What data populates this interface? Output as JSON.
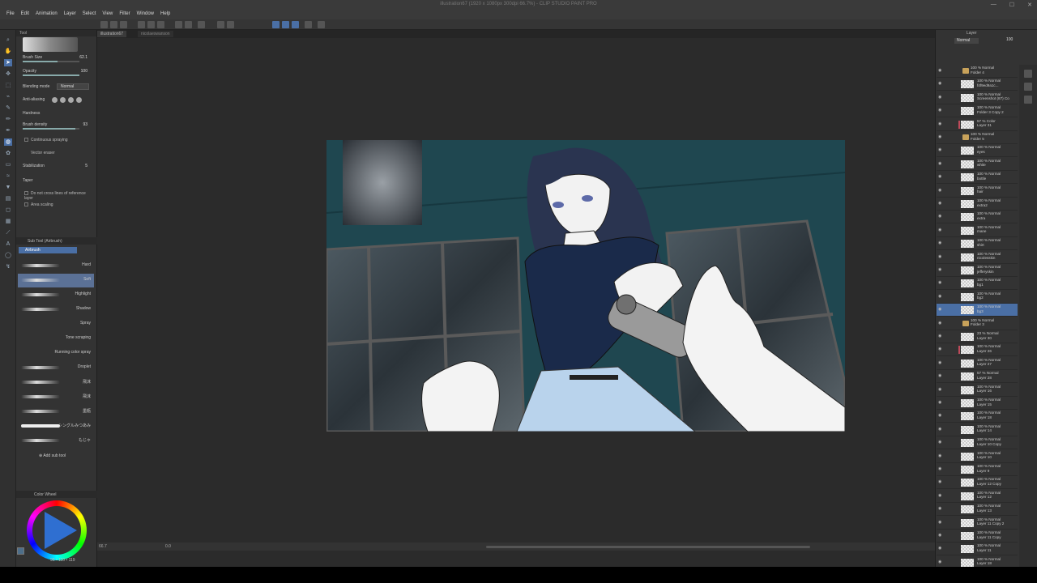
{
  "window": {
    "title": "illustration67 (1920 x 1080px 300dpi 66.7%) - CLIP STUDIO PAINT PRO"
  },
  "menu": [
    "File",
    "Edit",
    "Animation",
    "Layer",
    "Select",
    "View",
    "Filter",
    "Window",
    "Help"
  ],
  "tabs": [
    {
      "label": "illustration67"
    },
    {
      "label": "nicolaeswanson"
    }
  ],
  "tool_property": {
    "header": "Tool",
    "brush_size_label": "Brush Size",
    "brush_size_value": "62.1",
    "opacity_label": "Opacity",
    "opacity_value": "100",
    "blending_label": "Blending mode",
    "blending_value": "Normal",
    "antialias_label": "Anti-aliasing",
    "hardness_label": "Hardness",
    "density_label": "Brush density",
    "density_value": "93",
    "continuous_label": "Continuous spraying",
    "vector_eraser_label": "Vector eraser",
    "stabilization_label": "Stabilization",
    "stabilization_value": "5",
    "taper_label": "Taper",
    "no_cross_label": "Do not cross lines of reference layer",
    "area_scaling_label": "Area scaling"
  },
  "subtool": {
    "header": "Sub Tool (Airbrush)",
    "group": "Airbrush",
    "items": [
      "Hard",
      "Soft",
      "Highlight",
      "Shadow",
      "Spray",
      "Tone scraping",
      "Running color spray",
      "Droplet",
      "飛沫",
      "飛沫",
      "墨瓶",
      "シングルみつあみ",
      "もじゃ"
    ],
    "add_label": "Add sub tool"
  },
  "color_wheel": {
    "header": "Color Wheel",
    "hsv": "96 • 110 • 119",
    "current_color": "#4d6e8a"
  },
  "status": {
    "zoom": "66.7",
    "angle": "0.0"
  },
  "layer_panel": {
    "tab": "Layer",
    "blend": "Normal",
    "opacity": "100",
    "layers": [
      {
        "kind": "folder",
        "line1": "100 % Normal",
        "line2": "Folder 4"
      },
      {
        "kind": "layer",
        "line1": "100 % Normal",
        "line2": "f4f9ed9a1c..."
      },
      {
        "kind": "layer",
        "line1": "100 % Normal",
        "line2": "Screenshot (87) Co"
      },
      {
        "kind": "layer",
        "line1": "100 % Normal",
        "line2": "Folder 3 Copy 2"
      },
      {
        "kind": "layer",
        "line1": "57 % Color",
        "line2": "Layer 31",
        "clip": true
      },
      {
        "kind": "folder",
        "line1": "100 % Normal",
        "line2": "Folder 5"
      },
      {
        "kind": "layer",
        "line1": "100 % Normal",
        "line2": "eyes"
      },
      {
        "kind": "layer",
        "line1": "100 % Normal",
        "line2": "white"
      },
      {
        "kind": "layer",
        "line1": "100 % Normal",
        "line2": "bottle"
      },
      {
        "kind": "layer",
        "line1": "100 % Normal",
        "line2": "hair"
      },
      {
        "kind": "layer",
        "line1": "100 % Normal",
        "line2": "extra2"
      },
      {
        "kind": "layer",
        "line1": "100 % Normal",
        "line2": "extra"
      },
      {
        "kind": "layer",
        "line1": "100 % Normal",
        "line2": "mane"
      },
      {
        "kind": "layer",
        "line1": "100 % Normal",
        "line2": "shirt"
      },
      {
        "kind": "layer",
        "line1": "100 % Normal",
        "line2": "nicolesskin"
      },
      {
        "kind": "layer",
        "line1": "100 % Normal",
        "line2": "jefferyskin"
      },
      {
        "kind": "layer",
        "line1": "100 % Normal",
        "line2": "bg1"
      },
      {
        "kind": "layer",
        "line1": "100 % Normal",
        "line2": "bg2"
      },
      {
        "kind": "layer",
        "line1": "100 % Normal",
        "line2": "bg3",
        "selected": true
      },
      {
        "kind": "folder",
        "line1": "100 % Normal",
        "line2": "Folder 3"
      },
      {
        "kind": "layer",
        "line1": "23 % Normal",
        "line2": "Layer 30"
      },
      {
        "kind": "layer",
        "line1": "100 % Normal",
        "line2": "Layer 26",
        "clip": true
      },
      {
        "kind": "layer",
        "line1": "100 % Normal",
        "line2": "Layer 27"
      },
      {
        "kind": "layer",
        "line1": "57 % Normal",
        "line2": "Layer 28"
      },
      {
        "kind": "layer",
        "line1": "100 % Normal",
        "line2": "Layer 16"
      },
      {
        "kind": "layer",
        "line1": "100 % Normal",
        "line2": "Layer 15"
      },
      {
        "kind": "layer",
        "line1": "100 % Normal",
        "line2": "Layer 18"
      },
      {
        "kind": "layer",
        "line1": "100 % Normal",
        "line2": "Layer 14"
      },
      {
        "kind": "layer",
        "line1": "100 % Normal",
        "line2": "Layer 10 Copy"
      },
      {
        "kind": "layer",
        "line1": "100 % Normal",
        "line2": "Layer 10"
      },
      {
        "kind": "layer",
        "line1": "100 % Normal",
        "line2": "Layer 9"
      },
      {
        "kind": "layer",
        "line1": "100 % Normal",
        "line2": "Layer 12 Copy"
      },
      {
        "kind": "layer",
        "line1": "100 % Normal",
        "line2": "Layer 12"
      },
      {
        "kind": "layer",
        "line1": "100 % Normal",
        "line2": "Layer 13"
      },
      {
        "kind": "layer",
        "line1": "100 % Normal",
        "line2": "Layer 11 Copy 2"
      },
      {
        "kind": "layer",
        "line1": "100 % Normal",
        "line2": "Layer 11 Copy"
      },
      {
        "kind": "layer",
        "line1": "100 % Normal",
        "line2": "Layer 11"
      },
      {
        "kind": "layer",
        "line1": "100 % Normal",
        "line2": "Layer 18"
      }
    ]
  },
  "colors": {
    "accent": "#4a6fa5",
    "canvas_bg": "#1f4750",
    "panel_bg": "#333333"
  }
}
